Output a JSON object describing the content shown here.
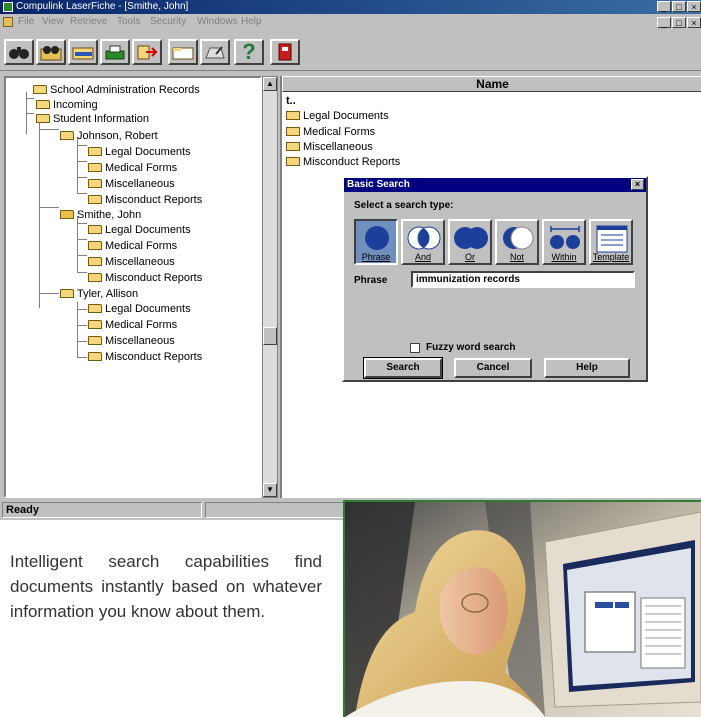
{
  "window": {
    "title": "Compulink LaserFiche - [Smithe, John]",
    "sys_buttons": [
      "_",
      "□",
      "×"
    ],
    "mdi_buttons": [
      "_",
      "□",
      "×"
    ]
  },
  "menu": [
    "File",
    "View",
    "Retrieve",
    "Tools",
    "Security",
    "Windows",
    "Help"
  ],
  "toolbar": {
    "buttons": [
      {
        "icon": "binoculars-icon"
      },
      {
        "icon": "search-folder-icon"
      },
      {
        "icon": "open-folder-icon"
      },
      {
        "icon": "print-icon"
      },
      {
        "icon": "export-icon"
      },
      {
        "icon": "new-folder-icon"
      },
      {
        "icon": "scanner-icon"
      },
      {
        "icon": "help-icon",
        "glyph": "?"
      },
      {
        "icon": "exit-icon"
      }
    ]
  },
  "tree": {
    "root": "School Administration Records",
    "incoming": "Incoming",
    "student_info": "Student Information",
    "students": [
      {
        "name": "Johnson, Robert",
        "docs": [
          "Legal Documents",
          "Medical Forms",
          "Miscellaneous",
          "Misconduct Reports"
        ]
      },
      {
        "name": "Smithe, John",
        "docs": [
          "Legal Documents",
          "Medical Forms",
          "Miscellaneous",
          "Misconduct Reports"
        ]
      },
      {
        "name": "Tyler, Allison",
        "docs": [
          "Legal Documents",
          "Medical Forms",
          "Miscellaneous",
          "Misconduct Reports"
        ]
      }
    ]
  },
  "list": {
    "column_header": "Name",
    "up_label": "t..",
    "items": [
      "Legal Documents",
      "Medical Forms",
      "Miscellaneous",
      "Misconduct Reports"
    ]
  },
  "status": {
    "text": "Ready"
  },
  "dialog": {
    "title": "Basic Search",
    "close": "×",
    "select_label": "Select a search type:",
    "types": [
      "Phrase",
      "And",
      "Or",
      "Not",
      "Within",
      "Template"
    ],
    "selected_type": "Phrase",
    "phrase_label": "Phrase",
    "phrase_value": "immunization records",
    "fuzzy_label": "Fuzzy word search",
    "fuzzy_checked": false,
    "buttons": [
      "Search",
      "Cancel",
      "Help"
    ]
  },
  "caption": "Intelligent search capabilities find documents instantly based on whatever information you know about them.",
  "colors": {
    "title_bar": "#08246b",
    "dialog_title": "#000080",
    "selected_type": "#6f8fbf",
    "photo_border": "#2e7d32"
  }
}
